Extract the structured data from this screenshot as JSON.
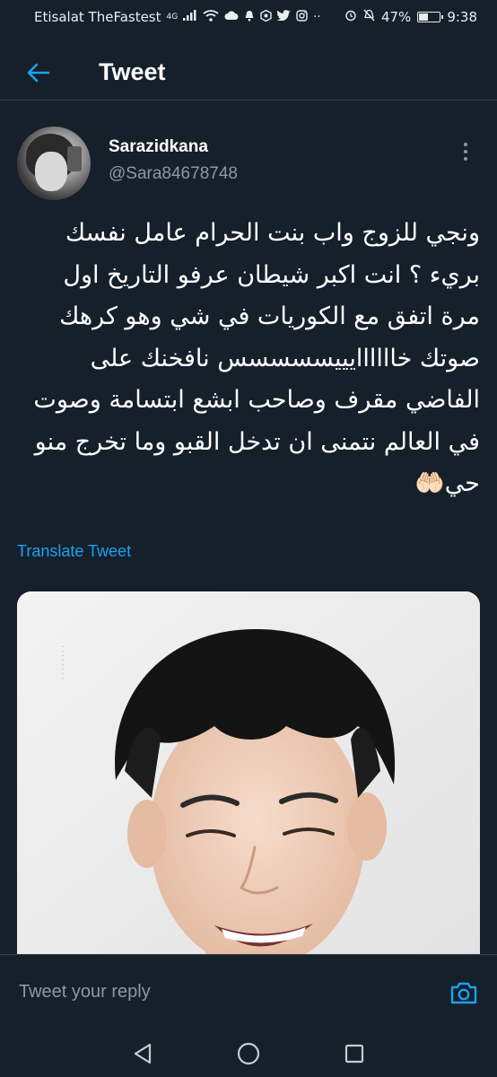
{
  "status_bar": {
    "carrier": "Etisalat TheFastest",
    "network": "4G",
    "battery_percent": "47%",
    "battery_level": 0.47,
    "time": "9:38"
  },
  "header": {
    "title": "Tweet"
  },
  "author": {
    "display_name": "Sarazidkana",
    "handle": "@Sara84678748"
  },
  "tweet": {
    "text": "ونجي للزوج واب بنت الحرام عامل نفسك بريء ؟ انت اكبر شيطان عرفو التاريخ اول مرة اتفق مع الكوريات في شي وهو كرهك صوتك خاااااايييسسسسس نافخنك على الفاضي مقرف وصاحب ابشع ابتسامة وصوت في العالم نتمنى ان تدخل القبو وما تخرج منو حي🤲🏻",
    "translate_label": "Translate Tweet"
  },
  "reply": {
    "placeholder": "Tweet your reply"
  },
  "colors": {
    "background": "#15202b",
    "accent": "#1da1f2",
    "secondary_text": "#8899a6",
    "divider": "#38444d"
  }
}
